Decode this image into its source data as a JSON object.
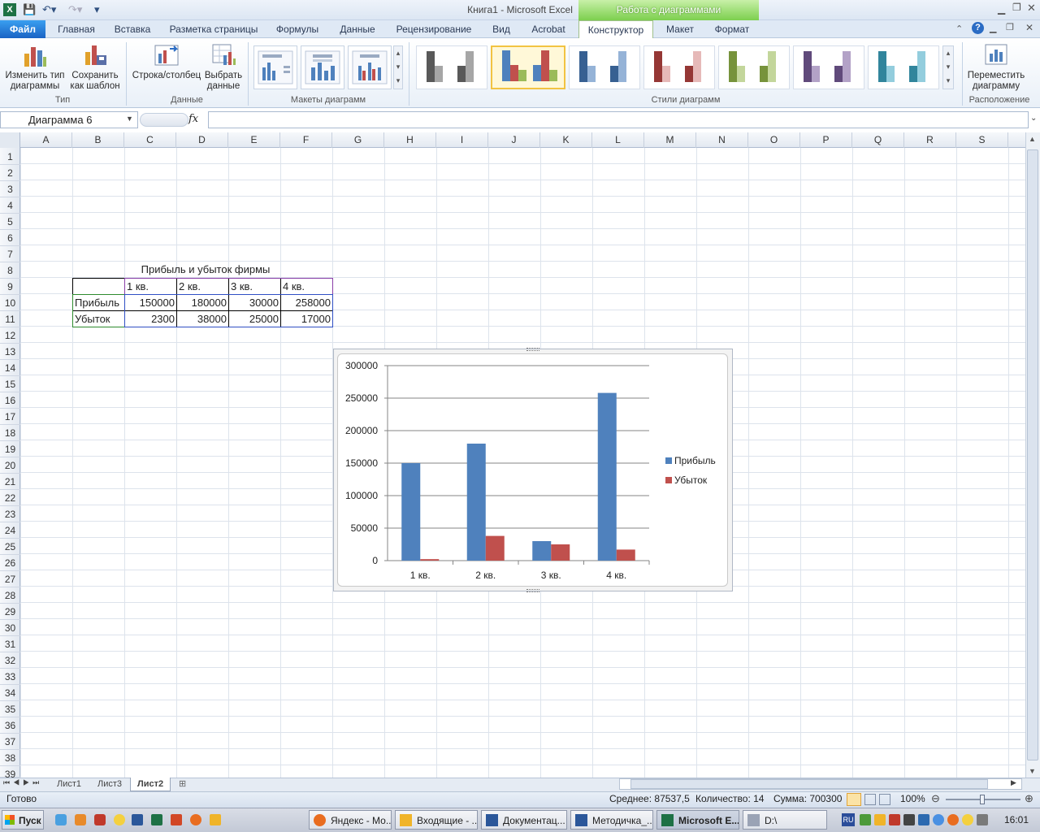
{
  "window": {
    "title": "Книга1  -  Microsoft Excel",
    "context_header": "Работа с диаграммами"
  },
  "menu": {
    "file": "Файл",
    "tabs": [
      "Главная",
      "Вставка",
      "Разметка страницы",
      "Формулы",
      "Данные",
      "Рецензирование",
      "Вид",
      "Acrobat",
      "Конструктор",
      "Макет",
      "Формат"
    ]
  },
  "ribbon": {
    "change_type": [
      "Изменить тип",
      "диаграммы"
    ],
    "save_template": [
      "Сохранить",
      "как шаблон"
    ],
    "group_type": "Тип",
    "row_col": "Строка/столбец",
    "select_data": [
      "Выбрать",
      "данные"
    ],
    "group_data": "Данные",
    "group_layouts": "Макеты диаграмм",
    "group_styles": "Стили диаграмм",
    "move_chart": [
      "Переместить",
      "диаграмму"
    ],
    "group_location": "Расположение"
  },
  "formula_bar": {
    "name_box": "Диаграмма 6",
    "fx": "fx",
    "value": ""
  },
  "columns": [
    "A",
    "B",
    "C",
    "D",
    "E",
    "F",
    "G",
    "H",
    "I",
    "J",
    "K",
    "L",
    "M",
    "N",
    "O",
    "P",
    "Q",
    "R",
    "S"
  ],
  "rows": [
    "1",
    "2",
    "3",
    "4",
    "5",
    "6",
    "7",
    "8",
    "9",
    "10",
    "11",
    "12",
    "13",
    "14",
    "15",
    "16",
    "17",
    "18",
    "19",
    "20",
    "21",
    "22",
    "23",
    "24",
    "25",
    "26",
    "27",
    "28",
    "29",
    "30",
    "31",
    "32",
    "33",
    "34",
    "35",
    "36",
    "37",
    "38",
    "39"
  ],
  "sheet": {
    "table_title": "Прибыль и убыток фирмы",
    "headers": [
      "1 кв.",
      "2 кв.",
      "3 кв.",
      "4 кв."
    ],
    "row_profit": {
      "label": "Прибыль",
      "values": [
        "150000",
        "180000",
        "30000",
        "258000"
      ]
    },
    "row_loss": {
      "label": "Убыток",
      "values": [
        "2300",
        "38000",
        "25000",
        "17000"
      ]
    }
  },
  "chart_data": {
    "type": "bar",
    "categories": [
      "1 кв.",
      "2 кв.",
      "3 кв.",
      "4 кв."
    ],
    "series": [
      {
        "name": "Прибыль",
        "values": [
          150000,
          180000,
          30000,
          258000
        ],
        "color": "#4f81bd"
      },
      {
        "name": "Убыток",
        "values": [
          2300,
          38000,
          25000,
          17000
        ],
        "color": "#c0504d"
      }
    ],
    "ylim": [
      0,
      300000
    ],
    "yticks": [
      "0",
      "50000",
      "100000",
      "150000",
      "200000",
      "250000",
      "300000"
    ],
    "grid": true,
    "legend": "right"
  },
  "sheet_tabs": [
    "Лист1",
    "Лист3",
    "Лист2"
  ],
  "status": {
    "ready": "Готово",
    "average": "Среднее: 87537,5",
    "count": "Количество: 14",
    "sum": "Сумма: 700300",
    "zoom": "100%"
  },
  "taskbar": {
    "start": "Пуск",
    "tasks": [
      "Яндекс - Мо...",
      "Входящие - ...",
      "Документац...",
      "Методичка_...",
      "Microsoft E...",
      "D:\\"
    ],
    "lang": "RU",
    "clock": "16:01"
  },
  "colors": {
    "excel_green": "#1e7145",
    "accent_blue": "#4f81bd",
    "accent_red": "#c0504d",
    "context_green": "#7ccf4e"
  }
}
